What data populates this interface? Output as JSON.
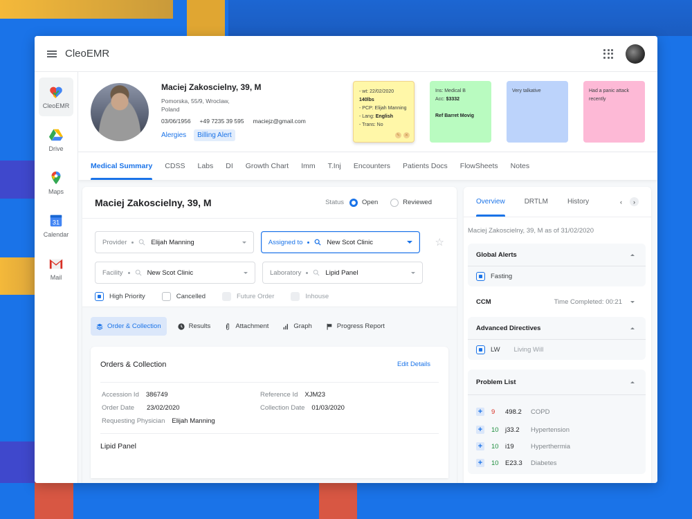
{
  "app": {
    "title": "CleoEMR"
  },
  "sidebar": {
    "items": [
      {
        "label": "CleoEMR",
        "icon": "heart-icon",
        "active": true
      },
      {
        "label": "Drive",
        "icon": "drive-icon",
        "active": false
      },
      {
        "label": "Maps",
        "icon": "maps-pin-icon",
        "active": false
      },
      {
        "label": "Calendar",
        "icon": "calendar-icon",
        "active": false,
        "day": "31"
      },
      {
        "label": "Mail",
        "icon": "mail-icon",
        "active": false
      }
    ]
  },
  "patient": {
    "name": "Maciej Zakoscielny, 39, M",
    "address": "Pomorska, 55/9, Wroclaw, Poland",
    "dob": "03/06/1956",
    "phone": "+49 7235 39 595",
    "email": "maciejz@gmail.com",
    "links": [
      "Alergies",
      "Billing Alert"
    ]
  },
  "notes": [
    {
      "color": "yellow",
      "lines": [
        {
          "text": "- wt: 22/02/2020",
          "bold": ""
        },
        {
          "text": "",
          "bold": "140lbs"
        },
        {
          "text": "- PCP: Elijah Manning",
          "bold": ""
        },
        {
          "text": "- Lang: ",
          "bold": "English"
        },
        {
          "text": "- Trans: No",
          "bold": ""
        }
      ]
    },
    {
      "color": "green",
      "lines": [
        {
          "text": "Ins: Medical B",
          "bold": ""
        },
        {
          "text": "Acc: ",
          "bold": "$3332"
        },
        {
          "text": "",
          "bold": ""
        },
        {
          "text": "",
          "bold": "Ref Barret Movig"
        }
      ]
    },
    {
      "color": "blue",
      "lines": [
        {
          "text": "Very talkative",
          "bold": ""
        }
      ]
    },
    {
      "color": "pink",
      "lines": [
        {
          "text": "Had a panic attack recently",
          "bold": ""
        }
      ]
    }
  ],
  "tabs": [
    "Medical Summary",
    "CDSS",
    "Labs",
    "DI",
    "Growth Chart",
    "Imm",
    "T.Inj",
    "Encounters",
    "Patients Docs",
    "FlowSheets",
    "Notes"
  ],
  "active_tab": "Medical Summary",
  "order": {
    "title": "Maciej Zakoscielny, 39, M",
    "status_label": "Status",
    "status_options": [
      "Open",
      "Reviewed"
    ],
    "status_selected": "Open",
    "fields": {
      "provider": {
        "label": "Provider",
        "value": "Elijah Manning"
      },
      "assigned_to": {
        "label": "Assigned to",
        "value": "New Scot Clinic"
      },
      "facility": {
        "label": "Facility",
        "value": "New Scot Clinic"
      },
      "laboratory": {
        "label": "Laboratory",
        "value": "Lipid Panel"
      }
    },
    "checkboxes": [
      {
        "label": "High Priority",
        "checked": true,
        "disabled": false
      },
      {
        "label": "Cancelled",
        "checked": false,
        "disabled": false
      },
      {
        "label": "Future Order",
        "checked": false,
        "disabled": true
      },
      {
        "label": "Inhouse",
        "checked": false,
        "disabled": true
      }
    ],
    "subtabs": [
      "Order & Collection",
      "Results",
      "Attachment",
      "Graph",
      "Progress Report"
    ],
    "active_subtab": "Order & Collection",
    "section_title": "Orders & Collection",
    "edit_label": "Edit Details",
    "details": {
      "accession_id": {
        "label": "Accession Id",
        "value": "386749"
      },
      "reference_id": {
        "label": "Reference Id",
        "value": "XJM23"
      },
      "order_date": {
        "label": "Order Date",
        "value": "23/02/2020"
      },
      "collection_date": {
        "label": "Collection Date",
        "value": "01/03/2020"
      },
      "requesting_physician": {
        "label": "Requesting Physician",
        "value": "Elijah Manning"
      }
    },
    "panel_name": "Lipid Panel"
  },
  "overview": {
    "tabs": [
      "Overview",
      "DRTLM",
      "History"
    ],
    "active_tab": "Overview",
    "as_of": "Maciej Zakoscielny, 39, M as of 31/02/2020",
    "global_alerts": {
      "title": "Global Alerts",
      "items": [
        {
          "label": "Fasting",
          "checked": true
        }
      ]
    },
    "ccm": {
      "title": "CCM",
      "time": "Time Completed: 00:21"
    },
    "advanced_directives": {
      "title": "Advanced Directives",
      "items": [
        {
          "code": "LW",
          "desc": "Living Will",
          "checked": true
        }
      ]
    },
    "problem_list": {
      "title": "Problem List",
      "items": [
        {
          "severity": "9",
          "severity_color": "#d93025",
          "code": "498.2",
          "name": "COPD"
        },
        {
          "severity": "10",
          "severity_color": "#1e8e3e",
          "code": "j33.2",
          "name": "Hypertension"
        },
        {
          "severity": "10",
          "severity_color": "#1e8e3e",
          "code": "i19",
          "name": "Hyperthermia"
        },
        {
          "severity": "10",
          "severity_color": "#1e8e3e",
          "code": "E23.3",
          "name": "Diabetes"
        }
      ]
    }
  },
  "colors": {
    "accent": "#1a73e8",
    "background": "#1a73e8",
    "note_yellow": "#fff7a8",
    "note_green": "#b9fbc0",
    "note_blue": "#bcd3fb",
    "note_pink": "#fdb9d6"
  }
}
